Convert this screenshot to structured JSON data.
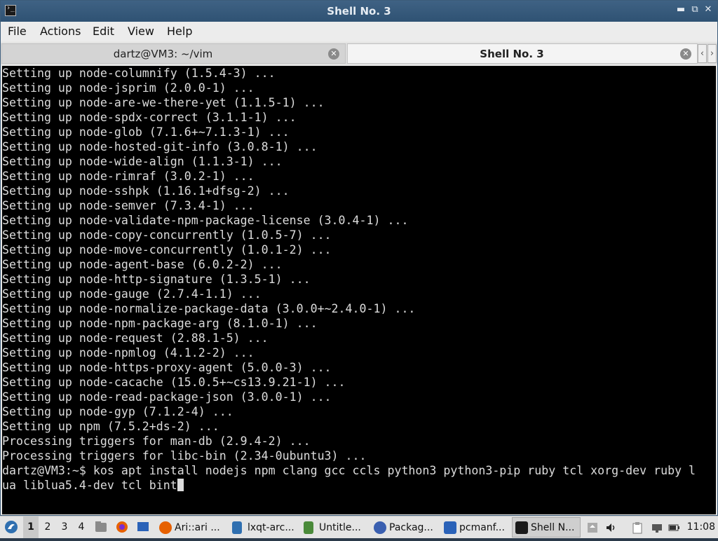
{
  "window": {
    "title": "Shell No. 3",
    "controls": {
      "minimize": "▬",
      "restore": "⧉",
      "close": "✕"
    }
  },
  "menu": [
    "File",
    "Actions",
    "Edit",
    "View",
    "Help"
  ],
  "tabs": [
    {
      "label": "dartz@VM3: ~/vim",
      "active": false
    },
    {
      "label": "Shell No. 3",
      "active": true
    }
  ],
  "tab_scroll": {
    "left": "‹",
    "right": "›"
  },
  "terminal": {
    "lines": [
      "Setting up node-columnify (1.5.4-3) ...",
      "Setting up node-jsprim (2.0.0-1) ...",
      "Setting up node-are-we-there-yet (1.1.5-1) ...",
      "Setting up node-spdx-correct (3.1.1-1) ...",
      "Setting up node-glob (7.1.6+~7.1.3-1) ...",
      "Setting up node-hosted-git-info (3.0.8-1) ...",
      "Setting up node-wide-align (1.1.3-1) ...",
      "Setting up node-rimraf (3.0.2-1) ...",
      "Setting up node-sshpk (1.16.1+dfsg-2) ...",
      "Setting up node-semver (7.3.4-1) ...",
      "Setting up node-validate-npm-package-license (3.0.4-1) ...",
      "Setting up node-copy-concurrently (1.0.5-7) ...",
      "Setting up node-move-concurrently (1.0.1-2) ...",
      "Setting up node-agent-base (6.0.2-2) ...",
      "Setting up node-http-signature (1.3.5-1) ...",
      "Setting up node-gauge (2.7.4-1.1) ...",
      "Setting up node-normalize-package-data (3.0.0+~2.4.0-1) ...",
      "Setting up node-npm-package-arg (8.1.0-1) ...",
      "Setting up node-request (2.88.1-5) ...",
      "Setting up node-npmlog (4.1.2-2) ...",
      "Setting up node-https-proxy-agent (5.0.0-3) ...",
      "Setting up node-cacache (15.0.5+~cs13.9.21-1) ...",
      "Setting up node-read-package-json (3.0.0-1) ...",
      "Setting up node-gyp (7.1.2-4) ...",
      "Setting up npm (7.5.2+ds-2) ...",
      "Processing triggers for man-db (2.9.4-2) ...",
      "Processing triggers for libc-bin (2.34-0ubuntu3) ...",
      "dartz@VM3:~$ kos apt install nodejs npm clang gcc ccls python3 python3-pip ruby tcl xorg-dev ruby l",
      "ua liblua5.4-dev tcl bint"
    ]
  },
  "taskbar": {
    "desktops": [
      "1",
      "2",
      "3",
      "4"
    ],
    "active_desktop": "1",
    "tasks": [
      {
        "label": "Ari::ari ...",
        "icon": "firefox-icon",
        "active": false
      },
      {
        "label": "lxqt-arc...",
        "icon": "document-icon",
        "active": false
      },
      {
        "label": "Untitle...",
        "icon": "text-editor-icon",
        "active": false
      },
      {
        "label": "Packag...",
        "icon": "package-manager-icon",
        "active": false
      },
      {
        "label": "pcmanf...",
        "icon": "folder-icon",
        "active": false
      },
      {
        "label": "Shell N...",
        "icon": "terminal-icon",
        "active": true
      }
    ],
    "clock": "11:08"
  },
  "colors": {
    "titlebar": "#3f6284",
    "terminal_bg": "#000000",
    "terminal_fg": "#dcdcdc"
  }
}
